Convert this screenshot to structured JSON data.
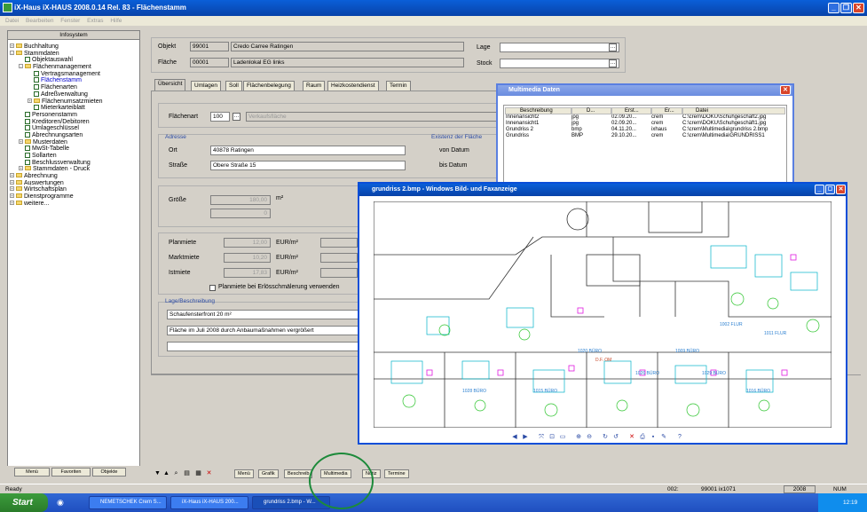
{
  "window": {
    "title": "iX-Haus iX-HAUS 2008.0.14 Rel. 83 - Flächenstamm"
  },
  "menu": [
    "Datei",
    "Bearbeiten",
    "Fenster",
    "Extras",
    "Hilfe"
  ],
  "tree": {
    "header": "Infosystem",
    "items": [
      {
        "label": "Buchhaltung",
        "depth": 0,
        "kind": "folder",
        "exp": "+"
      },
      {
        "label": "Stammdaten",
        "depth": 0,
        "kind": "folder",
        "exp": "-"
      },
      {
        "label": "Objektauswahl",
        "depth": 1,
        "kind": "check"
      },
      {
        "label": "Flächenmanagement",
        "depth": 1,
        "kind": "folder",
        "exp": "-"
      },
      {
        "label": "Vertragsmanagement",
        "depth": 2,
        "kind": "check"
      },
      {
        "label": "Flächenstamm",
        "depth": 2,
        "kind": "check",
        "selected": true
      },
      {
        "label": "Flächenarten",
        "depth": 2,
        "kind": "check"
      },
      {
        "label": "Adreßverwaltung",
        "depth": 2,
        "kind": "check"
      },
      {
        "label": "Flächenumsatzmieten",
        "depth": 2,
        "kind": "folder",
        "exp": "+"
      },
      {
        "label": "Mieterkarteiblatt",
        "depth": 2,
        "kind": "check"
      },
      {
        "label": "Personenstamm",
        "depth": 1,
        "kind": "check"
      },
      {
        "label": "Kreditoren/Debitoren",
        "depth": 1,
        "kind": "check"
      },
      {
        "label": "Umlageschlüssel",
        "depth": 1,
        "kind": "check"
      },
      {
        "label": "Abrechnungsarten",
        "depth": 1,
        "kind": "check"
      },
      {
        "label": "Musterdaten",
        "depth": 1,
        "kind": "folder",
        "exp": "+"
      },
      {
        "label": "MwSt-Tabelle",
        "depth": 1,
        "kind": "check"
      },
      {
        "label": "Sollarten",
        "depth": 1,
        "kind": "check"
      },
      {
        "label": "Beschlussverwaltung",
        "depth": 1,
        "kind": "check"
      },
      {
        "label": "Stammdaten - Druck",
        "depth": 1,
        "kind": "folder",
        "exp": "+"
      },
      {
        "label": "Abrechnung",
        "depth": 0,
        "kind": "folder",
        "exp": "+"
      },
      {
        "label": "Auswertungen",
        "depth": 0,
        "kind": "folder",
        "exp": "+"
      },
      {
        "label": "Wirtschaftsplan",
        "depth": 0,
        "kind": "folder",
        "exp": "+"
      },
      {
        "label": "Dienstprogramme",
        "depth": 0,
        "kind": "folder",
        "exp": "+"
      },
      {
        "label": "weitere...",
        "depth": 0,
        "kind": "folder",
        "exp": "+"
      }
    ],
    "tabs": [
      "Menü",
      "Favoriten",
      "Objekte"
    ]
  },
  "form": {
    "objekt_label": "Objekt",
    "objekt_nr": "99001",
    "objekt_name": "Credo Carree Ratingen",
    "flaeche_label": "Fläche",
    "flaeche_nr": "00001",
    "flaeche_name": "Ladenlokal EG links",
    "lage_label": "Lage",
    "stock_label": "Stock",
    "tabs": [
      "Übersicht",
      "Umlagen",
      "Soll",
      "Flächenbelegung",
      "Raum",
      "Heizkostendienst",
      "Termin"
    ],
    "flaechenart_label": "Flächenart",
    "flaechenart_value": "100",
    "flaechenart_text": "Verkaufsfläche",
    "adresse_title": "Adresse",
    "ort_label": "Ort",
    "ort_value": "40878 Ratingen",
    "strasse_label": "Straße",
    "strasse_value": "Obere Straße 15",
    "existenz_title": "Existenz der Fläche",
    "von_label": "von Datum",
    "bis_label": "bis Datum",
    "groesse_label": "Größe",
    "groesse_value": "180,00",
    "groesse_unit": "m²",
    "groesse_value2": "0",
    "planmiete_label": "Planmiete",
    "planmiete_value": "12,00",
    "marktmiete_label": "Marktmiete",
    "marktmiete_value": "10,20",
    "istmiete_label": "Istmiete",
    "istmiete_value": "17,83",
    "eur_unit": "EUR/m²",
    "checkbox_label": "Planmiete bei Erlösschmälerung verwenden",
    "lage_title": "Lage/Beschreibung",
    "desc1": "Schaufensterfront 20 m²",
    "desc2": "Fläche im Juli 2008 durch Anbaumaßnahmen vergrößert"
  },
  "toolbar": {
    "buttons": [
      "Menü",
      "Grafik",
      "Beschreib",
      "Multimedia",
      "Notiz",
      "Termine"
    ]
  },
  "status": {
    "left": "Ready",
    "a": "002:",
    "b": "99001 ix1071",
    "year": "2008",
    "num": "NUM"
  },
  "taskbar": {
    "start": "Start",
    "tasks": [
      "NEMETSCHEK Crem S...",
      "iX-Haus iX-HAUS 200...",
      "grundriss 2.bmp - W..."
    ],
    "time": "12:19"
  },
  "multimedia": {
    "title": "Multimedia Daten",
    "columns": [
      "Beschreibung",
      "D...",
      "Erst...",
      "Er...",
      "Datei"
    ],
    "rows": [
      [
        "Innenansicht2",
        "jpg",
        "02.09.20...",
        "crem",
        "C:\\crem\\DOKU\\Schuhgeschäft2.jpg"
      ],
      [
        "Innenansicht1",
        "jpg",
        "02.09.20...",
        "crem",
        "C:\\crem\\DOKU\\Schuhgeschäft1.jpg"
      ],
      [
        "Grundriss 2",
        "bmp",
        "04.11.20...",
        "ixhaus",
        "C:\\crem\\Multimedia\\grundriss 2.bmp"
      ],
      [
        "Grundriss",
        "BMP",
        "29.10.20...",
        "crem",
        "C:\\crem\\Multimedia\\GRUNDRISS1"
      ]
    ]
  },
  "viewer": {
    "title": "grundriss 2.bmp - Windows Bild- und Faxanzeige",
    "rooms": [
      "1020 BÜRO",
      "1026 BÜRO",
      "1029 BÜRO",
      "1028 BÜRO",
      "1009 BÜRO",
      "D.F. OM",
      "1002 FLUR",
      "1011 FLUR",
      "1015 BÜRO",
      "1016 BÜRO"
    ]
  },
  "colors": {
    "titlebar": "#0a5fd8",
    "plan_lines": "#333333",
    "plan_cyan": "#00b4c8",
    "plan_green": "#2bc42b",
    "plan_magenta": "#e01ae0",
    "highlight_circle": "#1c8a3a"
  }
}
